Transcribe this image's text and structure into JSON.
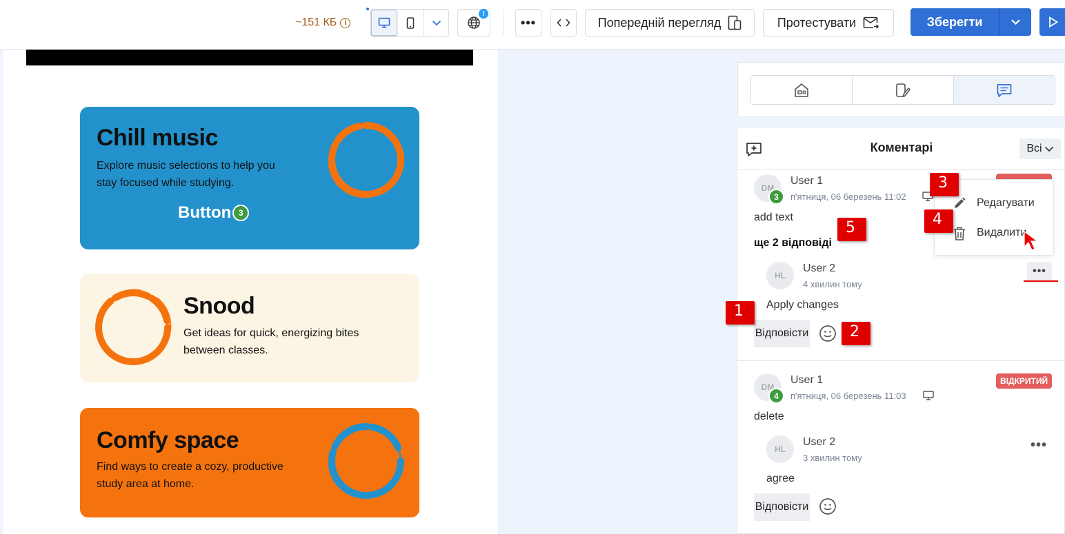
{
  "toolbar": {
    "size": "~151 КБ",
    "info_icon": "i",
    "globe_badge": "!",
    "more": "•••",
    "preview_label": "Попередній перегляд",
    "test_label": "Протестувати",
    "save_label": "Зберегти",
    "icons": [
      "info-icon",
      "desktop-icon",
      "mobile-icon",
      "chevron-down-icon",
      "globe-icon",
      "more-icon",
      "code-icon",
      "preview-icon",
      "email-test-icon",
      "play-icon"
    ]
  },
  "canvas": {
    "cards": [
      {
        "title": "Chill music",
        "desc1": "Explore music selections to help you",
        "desc2": "stay focused while studying.",
        "button": "Button",
        "pin": "3",
        "bg": "#2392cc",
        "ring": "#f5730e"
      },
      {
        "title": "Snood",
        "desc1": "Get ideas for quick, energizing bites",
        "desc2": "between classes.",
        "bg": "#fdf5e4",
        "ring": "#f5730e"
      },
      {
        "title": "Comfy space",
        "desc1": "Find ways to create a cozy, productive",
        "desc2": "study area at home.",
        "bg": "#f5730e",
        "ring": "#2392cc"
      }
    ]
  },
  "sidebar": {
    "tabs": [
      "blocks-icon",
      "styles-icon",
      "comments-icon"
    ],
    "comments": {
      "title": "Коментарі",
      "filter": "Всі",
      "threads": [
        {
          "avatar": "DM",
          "badge": "3",
          "user": "User 1",
          "date": "п'ятниця, 06 березень 11:02",
          "text": "add text",
          "more_replies": "ще 2 відповіді",
          "reply": {
            "avatar": "HL",
            "user": "User 2",
            "date": "4 хвилин тому",
            "text": "Apply changes"
          },
          "reply_btn": "Відповісти"
        },
        {
          "avatar": "DM",
          "badge": "4",
          "user": "User 1",
          "date": "п'ятниця, 06 березень 11:03",
          "status": "ВІДКРИТИЙ",
          "text": "delete",
          "reply": {
            "avatar": "HL",
            "user": "User 2",
            "date": "3 хвилин тому",
            "text": "agree"
          },
          "reply_btn": "Відповісти"
        }
      ],
      "menu": {
        "edit": "Редагувати",
        "delete": "Видалити"
      },
      "dots": "•••"
    }
  },
  "markers": [
    "1",
    "2",
    "3",
    "4",
    "5"
  ],
  "colors": {
    "accent": "#2f6fd6",
    "status": "#e35d5d",
    "marker": "#e00000",
    "badge": "#3f9c3f"
  }
}
